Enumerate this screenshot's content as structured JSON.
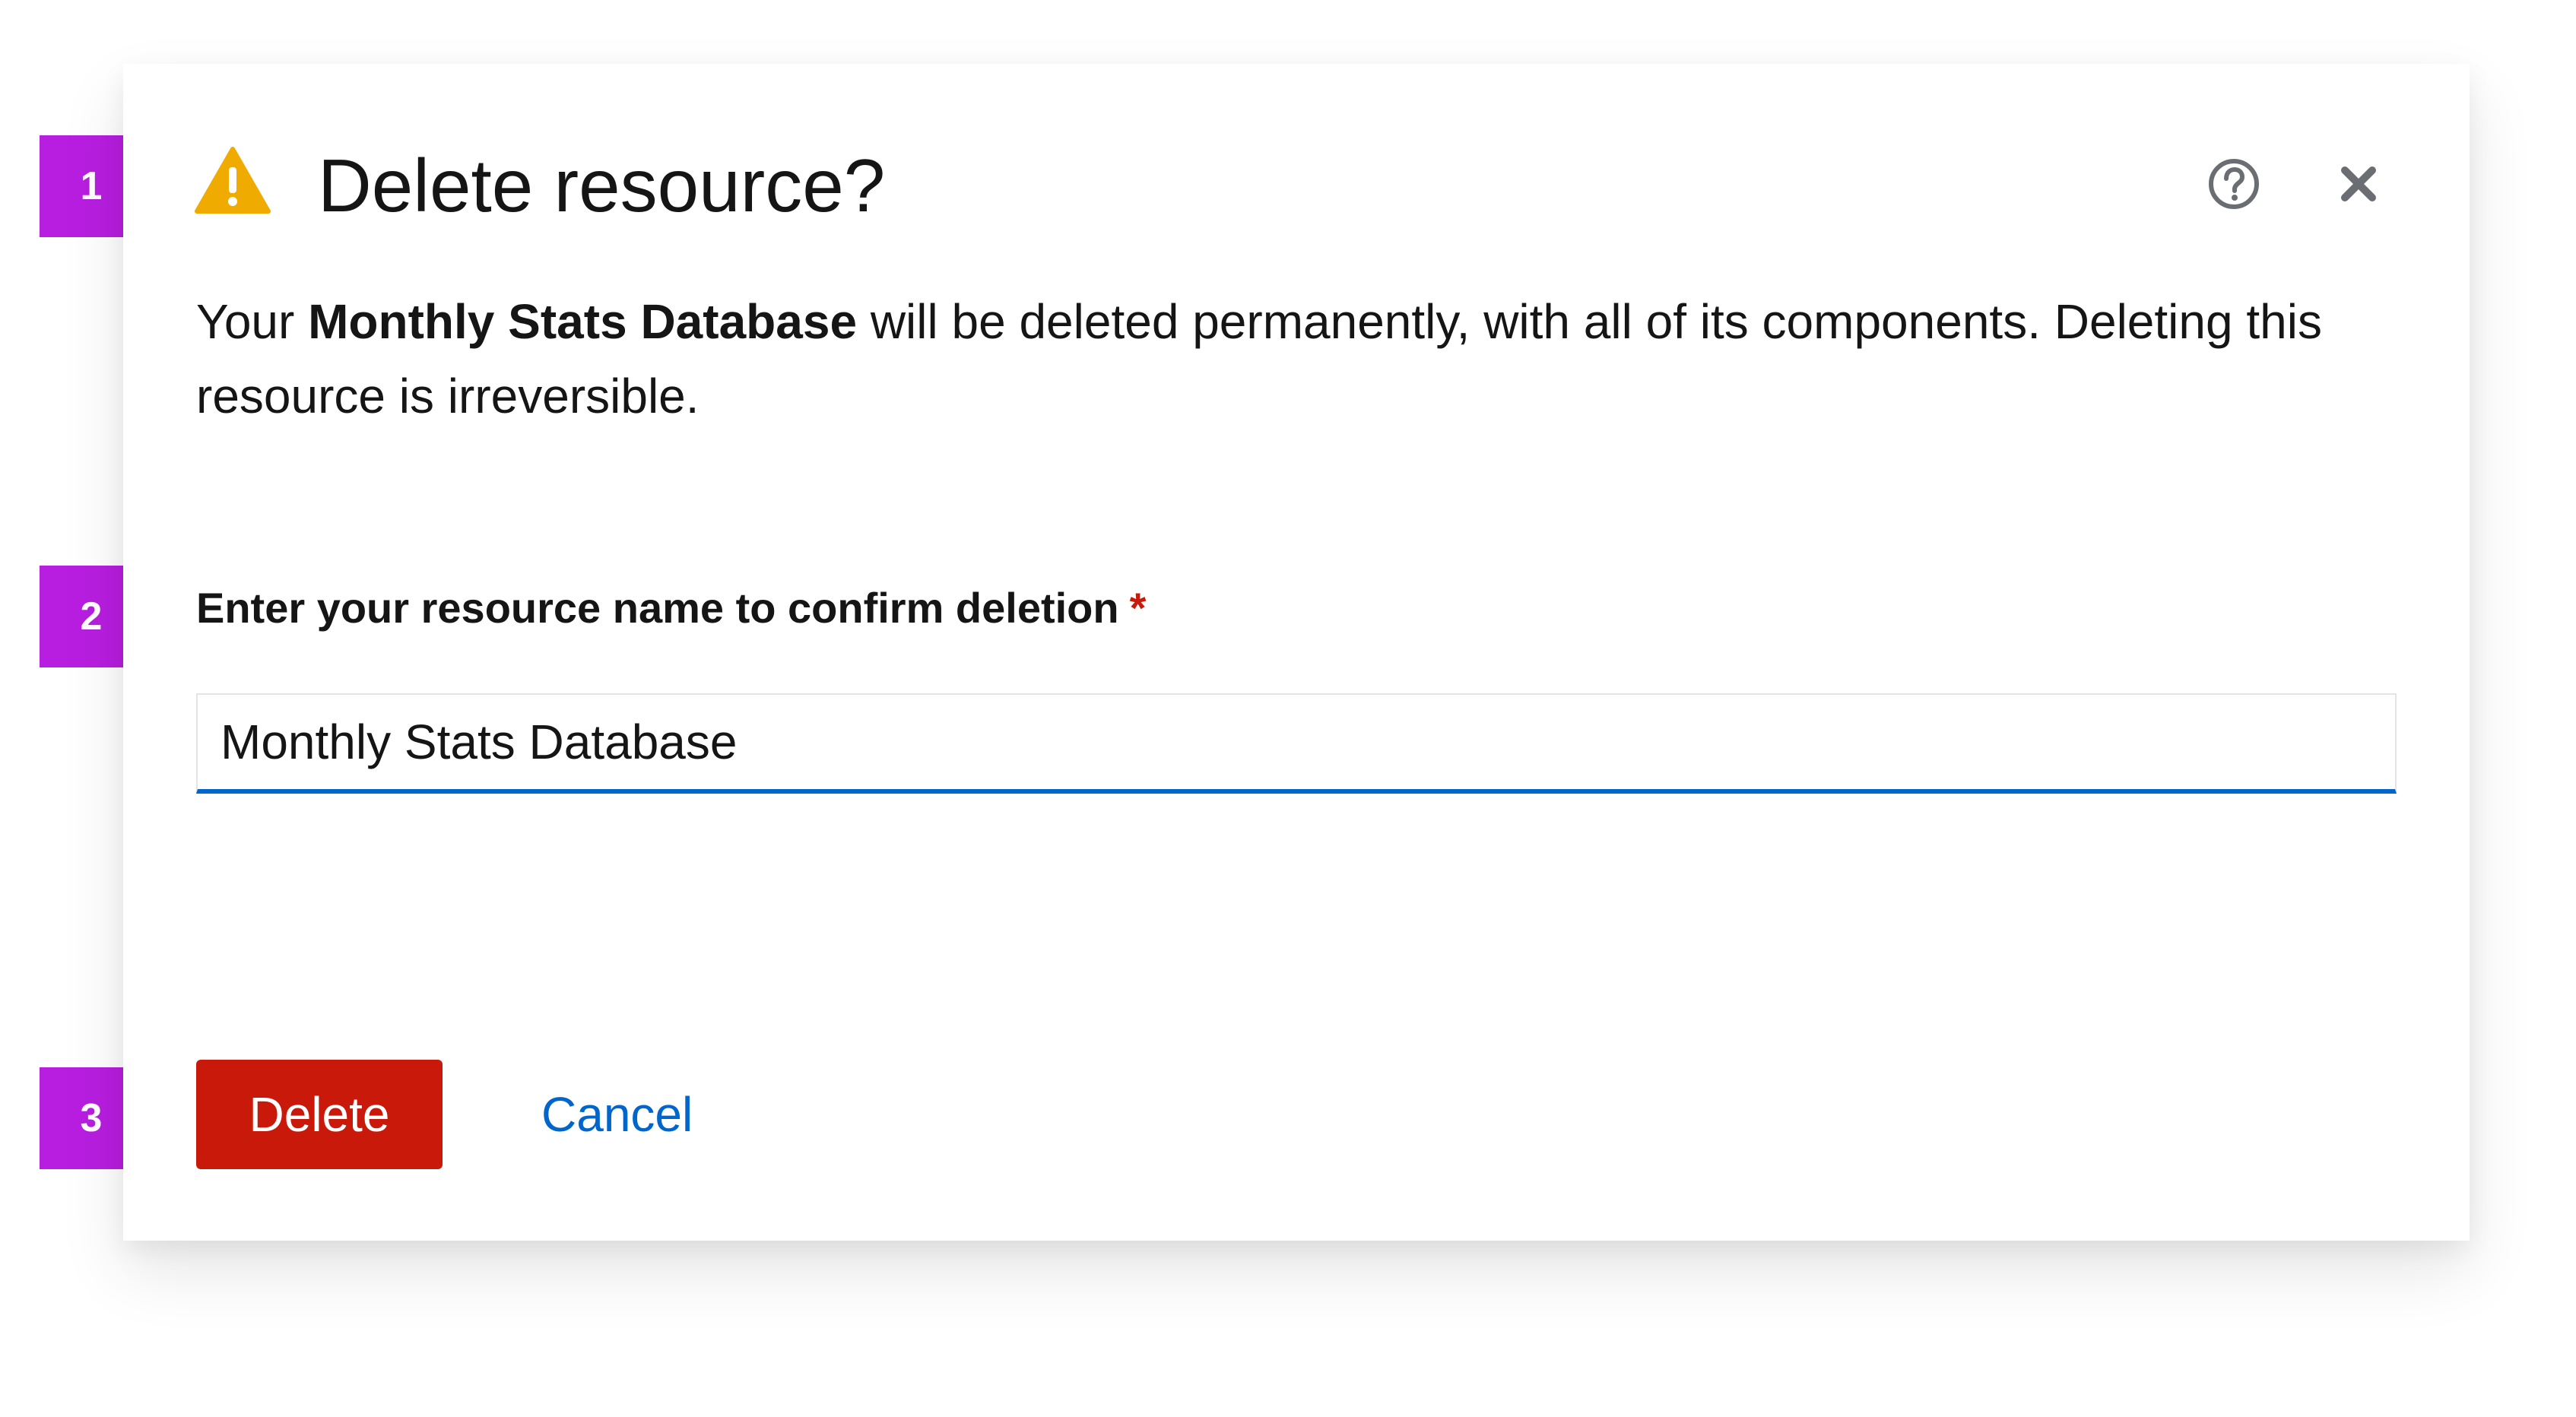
{
  "callouts": [
    "1",
    "2",
    "3"
  ],
  "modal": {
    "title": "Delete resource?",
    "warning_icon": "warning-triangle-icon",
    "help_icon": "help-circle-icon",
    "close_icon": "close-icon",
    "body": {
      "prefix": "Your ",
      "resource_name": "Monthly Stats Database",
      "suffix": " will be deleted permanently, with all of its components. Deleting this resource is irreversible."
    },
    "field": {
      "label": "Enter your resource name to confirm deletion",
      "required_marker": "*",
      "value": "Monthly Stats Database"
    },
    "actions": {
      "delete_label": "Delete",
      "cancel_label": "Cancel"
    }
  },
  "colors": {
    "danger": "#c9190b",
    "link": "#0066cc",
    "warning": "#f0ab00",
    "callout": "#b81ee0"
  }
}
